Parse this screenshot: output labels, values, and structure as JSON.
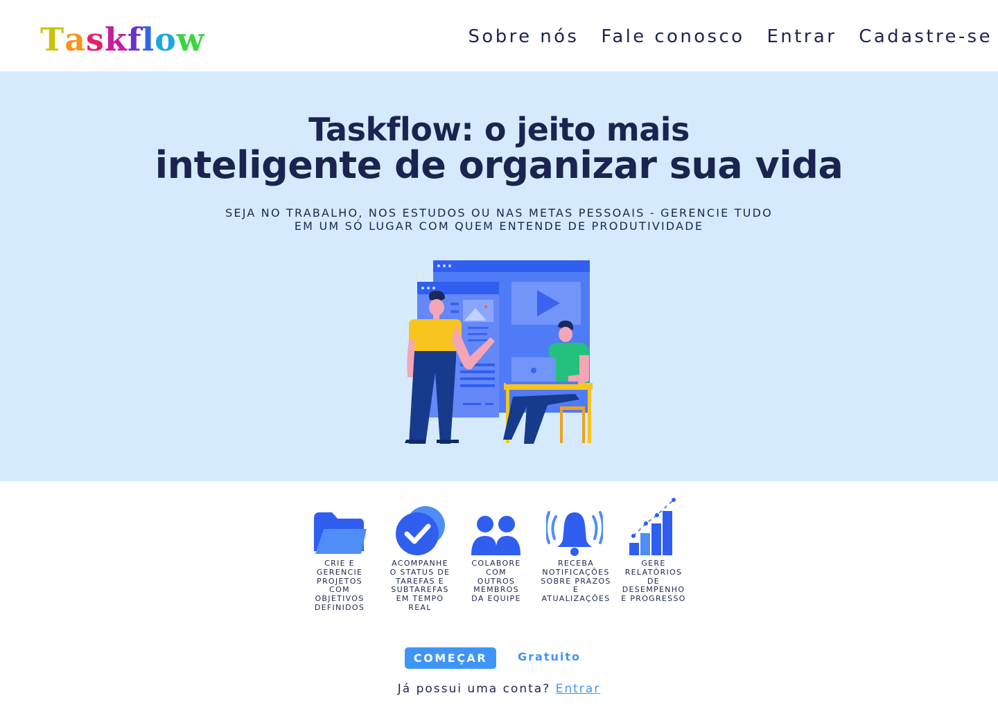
{
  "header": {
    "logo": [
      "T",
      "a",
      "s",
      "k",
      "f",
      "l",
      "o",
      "w"
    ],
    "logo_colors": [
      "#c8c20e",
      "#f7941d",
      "#e91e63",
      "#c51d9b",
      "#6a32c7",
      "#2f67e8",
      "#1aa9e0",
      "#3ad641"
    ],
    "nav": {
      "about": "Sobre nós",
      "contact": "Fale conosco",
      "login": "Entrar",
      "signup": "Cadastre-se"
    }
  },
  "hero": {
    "title_line1": "Taskflow: o jeito mais",
    "title_line2": "inteligente de organizar sua vida",
    "subtitle_line1": "SEJA NO TRABALHO, NOS ESTUDOS OU NAS METAS PESSOAIS - GERENCIE TUDO",
    "subtitle_line2": "EM UM SÓ LUGAR COM QUEM ENTENDE DE PRODUTIVIDADE",
    "illustration": "team-working-on-screens-illustration"
  },
  "features": [
    {
      "icon": "folder-icon",
      "text": "Crie e gerencie projetos com objetivos definidos"
    },
    {
      "icon": "check-circle-icon",
      "text": "Acompanhe o status de tarefas e subtarefas em tempo real"
    },
    {
      "icon": "users-icon",
      "text": "Colabore com outros membros da equipe"
    },
    {
      "icon": "bell-icon",
      "text": "Receba notificações sobre prazos e atualizações"
    },
    {
      "icon": "bar-chart-icon",
      "text": "Gere relatórios de desempenho e progresso"
    }
  ],
  "cta": {
    "button": "COMEÇAR",
    "free": "Gratuito",
    "login_prompt": "Já possui uma conta?",
    "login_link": "Entrar"
  },
  "colors": {
    "primary": "#3f95f5",
    "icon_blue": "#3a6df0",
    "navy": "#1b2450",
    "hero_bg": "#d5ebfd"
  }
}
